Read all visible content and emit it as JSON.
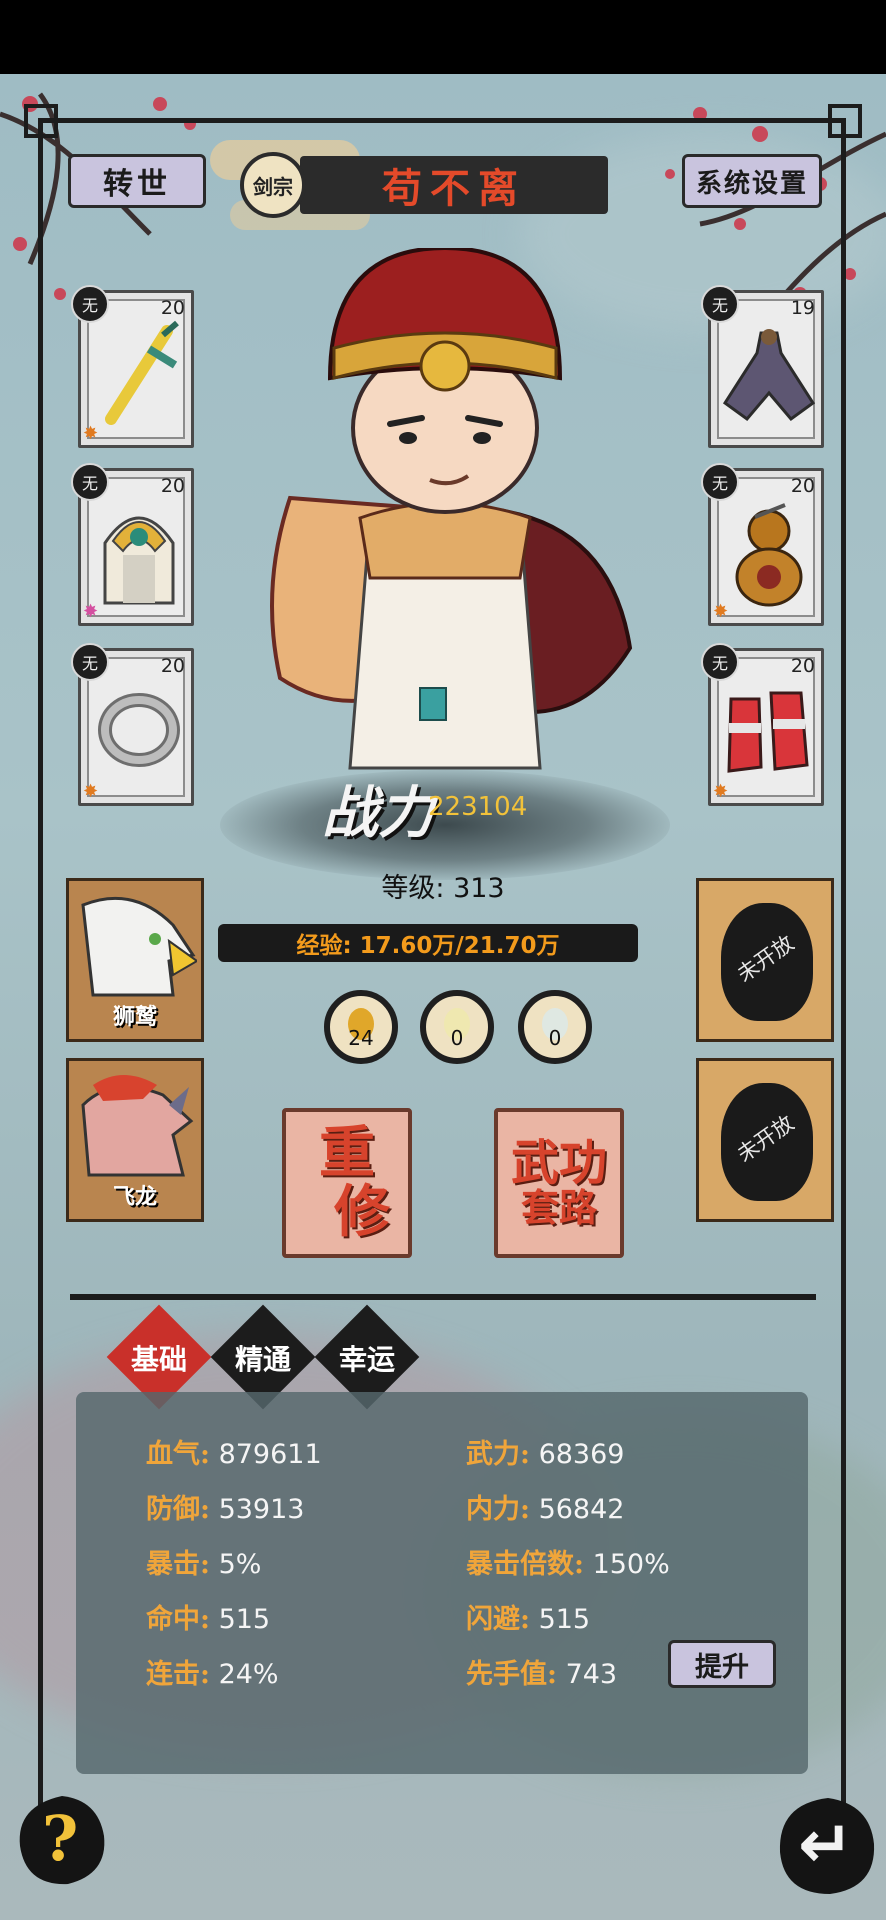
{
  "header": {
    "rebirth_label": "转世",
    "sect_label": "剑宗",
    "character_name": "苟不离",
    "settings_label": "系统设置"
  },
  "equipment_left": [
    {
      "quality": "无",
      "level": "20",
      "item": "sword-icon",
      "star_color": "#e07a20"
    },
    {
      "quality": "无",
      "level": "20",
      "item": "helmet-icon",
      "star_color": "#d44fa0"
    },
    {
      "quality": "无",
      "level": "20",
      "item": "ring-icon",
      "star_color": "#e07a20"
    }
  ],
  "equipment_right": [
    {
      "quality": "无",
      "level": "19",
      "item": "cloak-icon",
      "star_color": ""
    },
    {
      "quality": "无",
      "level": "20",
      "item": "gourd-icon",
      "star_color": "#e07a20"
    },
    {
      "quality": "无",
      "level": "20",
      "item": "boots-icon",
      "star_color": "#e07a20"
    }
  ],
  "combat": {
    "power_label": "战力",
    "power_value": "223104",
    "level_text": "等级: 313",
    "exp_text": "经验: 17.60万/21.70万"
  },
  "resources": [
    {
      "icon": "gold-egg-icon",
      "count": "24"
    },
    {
      "icon": "pale-egg-icon",
      "count": "0"
    },
    {
      "icon": "crystal-egg-icon",
      "count": "0"
    }
  ],
  "pets": [
    {
      "name": "狮鹫"
    },
    {
      "name": "飞龙"
    }
  ],
  "locked_slots": [
    {
      "label": "未开放"
    },
    {
      "label": "未开放"
    }
  ],
  "actions": {
    "retrain": [
      "重",
      "修"
    ],
    "martial": [
      "武功",
      "套路"
    ]
  },
  "tabs": [
    {
      "label": "基础",
      "active": true
    },
    {
      "label": "精通",
      "active": false
    },
    {
      "label": "幸运",
      "active": false
    }
  ],
  "stats": {
    "left": [
      {
        "key": "血气:",
        "value": "879611"
      },
      {
        "key": "防御:",
        "value": "53913"
      },
      {
        "key": "暴击:",
        "value": "5%"
      },
      {
        "key": "命中:",
        "value": "515"
      },
      {
        "key": "连击:",
        "value": "24%"
      }
    ],
    "right": [
      {
        "key": "武力:",
        "value": "68369"
      },
      {
        "key": "内力:",
        "value": "56842"
      },
      {
        "key": "暴击倍数:",
        "value": "150%"
      },
      {
        "key": "闪避:",
        "value": "515"
      },
      {
        "key": "先手值:",
        "value": "743"
      }
    ],
    "upgrade_label": "提升"
  },
  "footer": {
    "help_glyph": "?",
    "back_glyph": "↵"
  }
}
